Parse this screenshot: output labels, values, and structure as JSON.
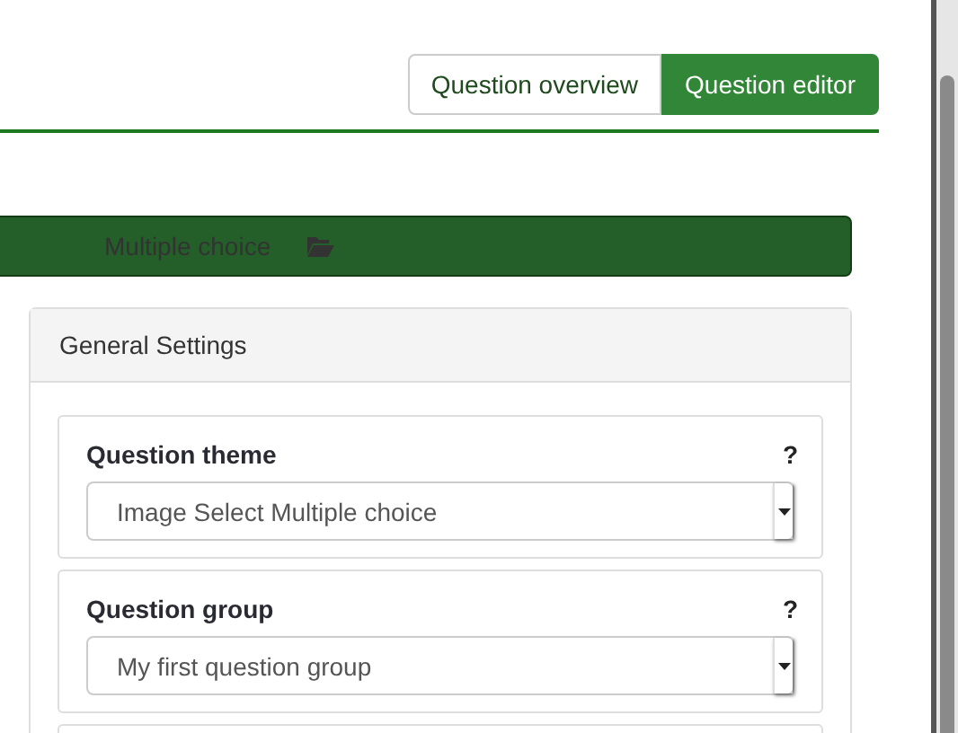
{
  "tabs": [
    {
      "label": "Question overview",
      "selected": false
    },
    {
      "label": "Question editor",
      "selected": true
    }
  ],
  "question_type_bar": {
    "label": "Multiple choice"
  },
  "panel": {
    "title": "General Settings",
    "fields": [
      {
        "label": "Question theme",
        "help": "?",
        "value": "Image Select Multiple choice"
      },
      {
        "label": "Question group",
        "help": "?",
        "value": "My first question group"
      }
    ]
  }
}
